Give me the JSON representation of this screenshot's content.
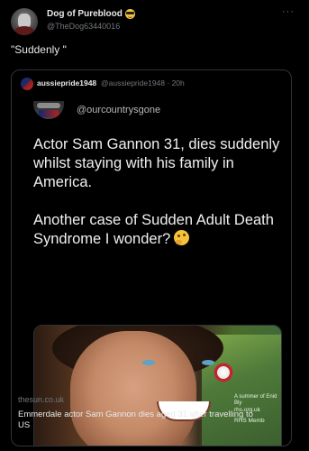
{
  "author": {
    "display_name": "Dog of Pureblood",
    "handle": "@TheDog63440016",
    "emoji": "sunglasses-face-emoji"
  },
  "more_icon": "···",
  "tweet_text": "\"Suddenly \"",
  "quoted": {
    "display_name": "aussiepride1948",
    "handle_time": "@aussiepride1948 · 20h",
    "embedded_handle": "@ourcountrysgone",
    "headline_1": "Actor Sam Gannon 31, dies suddenly whilst staying with his family in America.",
    "headline_2": "Another case of Sudden Adult Death Syndrome I wonder?",
    "emoji": "thinking-face-emoji",
    "link": {
      "domain": "thesun.co.uk",
      "title": "Emmerdale actor Sam Gannon dies aged 31 after travelling to US",
      "sign_text_1": "A summer of Enid Bly",
      "sign_text_2": "rhs.org.uk",
      "sign_text_3": "RHS Memb"
    }
  }
}
